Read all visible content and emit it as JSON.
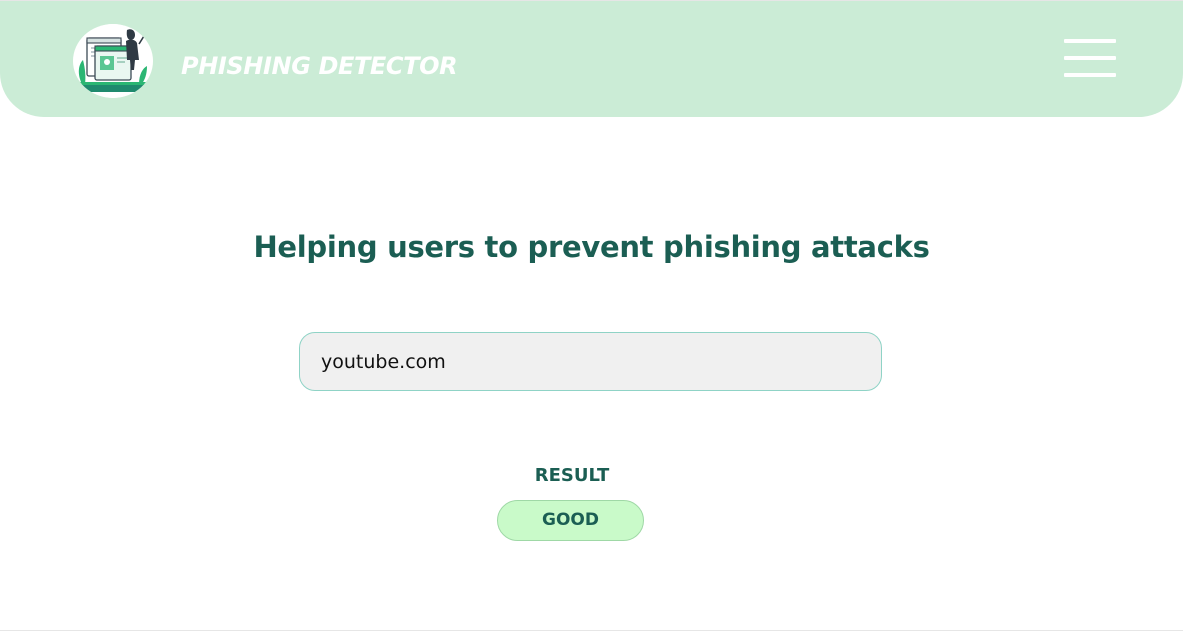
{
  "header": {
    "brand_title": "PHISHING DETECTOR",
    "logo_icon": "phishing-hacker-illustration-icon",
    "menu_icon": "hamburger-menu-icon"
  },
  "main": {
    "headline": "Helping users to prevent phishing attacks",
    "url_input": {
      "value": "youtube.com"
    },
    "result": {
      "label": "RESULT",
      "value": "GOOD"
    }
  },
  "colors": {
    "header_bg": "#cbecd6",
    "accent_text": "#1b5e53",
    "input_bg": "#f0f0f0",
    "input_border": "#8fd3c6",
    "badge_bg": "#c9fac9",
    "badge_border": "#9fd8a6"
  }
}
